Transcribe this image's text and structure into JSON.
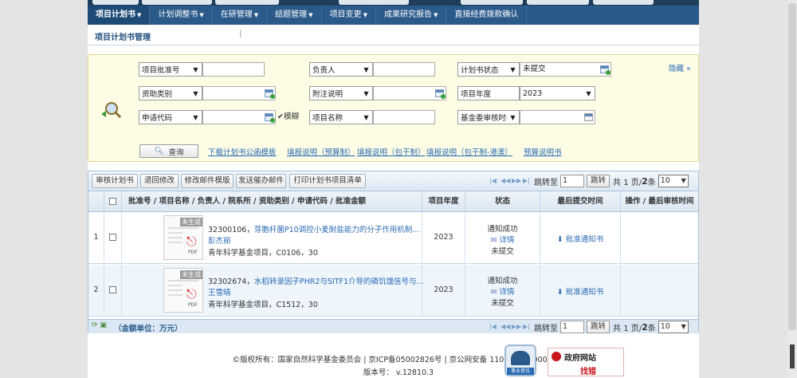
{
  "top_nav": {
    "items": [
      "项目计划书",
      "计划调整书",
      "在研管理",
      "结题管理",
      "项目变更",
      "成果研究报告",
      "直接经费拨款确认"
    ]
  },
  "sub_nav": {
    "label": "项目计划书管理"
  },
  "filter": {
    "row1": {
      "f1": "项目批准号",
      "f2": "负责人",
      "f3": "计划书状态",
      "f3_val": "未提交"
    },
    "row2": {
      "f1": "资助类别",
      "f2": "附注说明",
      "f3": "项目年度",
      "f3_val": "2023"
    },
    "row3": {
      "f1": "申请代码",
      "fuzzy": "模糊",
      "f2": "项目名称",
      "f3": "基金委审核时间"
    },
    "hide_label": "隐藏",
    "query_label": "查询",
    "links": [
      "下载计划书公函模板",
      "填报说明（预算制）",
      "填报说明（包干制）",
      "填报说明（包干制-港澳）",
      "预算说明书"
    ]
  },
  "toolbar": {
    "buttons": [
      "审核计划书",
      "退回修改",
      "修改邮件模版",
      "发送催办邮件",
      "打印计划书项目清单"
    ]
  },
  "pager": {
    "jump_label": "跳转至",
    "page_input": "1",
    "jump_btn": "跳转",
    "total_text": "共 1 页/",
    "total_pages": "2",
    "items_label": "条",
    "page_size": "10"
  },
  "table": {
    "headers": {
      "main": "批准号 / 项目名称 / 负责人 / 院系所 / 资助类别 / 申请代码 / 批准金额",
      "year": "项目年度",
      "status": "状态",
      "last_submit": "最后提交时间",
      "ops": "操作 / 最后审核时间"
    },
    "rows": [
      {
        "idx": "1",
        "code": "32300106",
        "title": "芽胞杆菌P10调控小麦耐盐能力的分子作用机制...",
        "person": "彭杰丽",
        "meta": "青年科学基金项目，C0106，30",
        "year": "2023",
        "status1": "通知成功",
        "detail": "详情",
        "status2": "未提交",
        "notice": "批准通知书",
        "thumb_tag": "未生成",
        "thumb_pdf": "PDF"
      },
      {
        "idx": "2",
        "code": "32302674",
        "title": "水稻转录因子PHR2与SITF1介导的磷饥饿信号与...",
        "person": "王雪晴",
        "meta": "青年科学基金项目，C1512，30",
        "year": "2023",
        "status1": "通知成功",
        "detail": "详情",
        "status2": "未提交",
        "notice": "批准通知书",
        "thumb_tag": "未生成",
        "thumb_pdf": "PDF"
      }
    ],
    "footer": "（金额单位：万元）"
  },
  "footer": {
    "copyright": "©版权所有：国家自然科学基金委员会 | 京ICP备05002826号 | 京公网安备 11040202500068号",
    "version": "版本号： v.12810.3",
    "gov_badge_l1": "政府网站",
    "gov_badge_l2": "找错",
    "org_badge": "事业单位"
  }
}
